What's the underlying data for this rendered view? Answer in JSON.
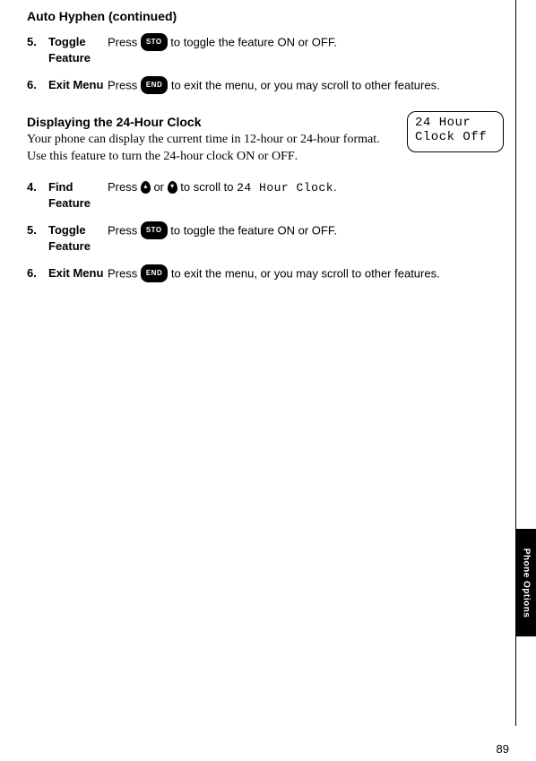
{
  "heading": "Auto Hyphen (continued)",
  "section1_steps": [
    {
      "num": "5.",
      "label": "Toggle Feature",
      "desc_pre": "Press ",
      "btn": "STO",
      "btn_type": "pill",
      "desc_post": " to toggle the feature ON or OFF."
    },
    {
      "num": "6.",
      "label": "Exit Menu",
      "desc_pre": "Press ",
      "btn": "END",
      "btn_type": "pill",
      "desc_post": " to exit the menu, or you may scroll to other features."
    }
  ],
  "sub_heading": "Displaying the 24-Hour Clock",
  "intro_pre": "Your phone can display the current time in 12-hour or 24-hour format. Use this feature to turn the 24-hour clock ",
  "intro_on": "ON",
  "intro_mid": " or ",
  "intro_off": "OFF",
  "intro_post": ".",
  "display_line1": "24 Hour",
  "display_line2": "Clock Off",
  "section2_steps": [
    {
      "num": "4.",
      "label": "Find Feature",
      "desc": "scroll_to"
    },
    {
      "num": "5.",
      "label": "Toggle Feature",
      "desc_pre": "Press ",
      "btn": "STO",
      "btn_type": "pill",
      "desc_post": " to toggle the feature ON or OFF."
    },
    {
      "num": "6.",
      "label": "Exit Menu",
      "desc_pre": "Press ",
      "btn": "END",
      "btn_type": "pill",
      "desc_post": " to exit the menu, or you may scroll to other features."
    }
  ],
  "scroll_step": {
    "pre": "Press ",
    "up": "▴",
    "mid": " or ",
    "down": "▾",
    "post1": " to scroll to ",
    "target": "24 Hour Clock",
    "post2": "."
  },
  "side_tab": "Phone Options",
  "page_number": "89"
}
